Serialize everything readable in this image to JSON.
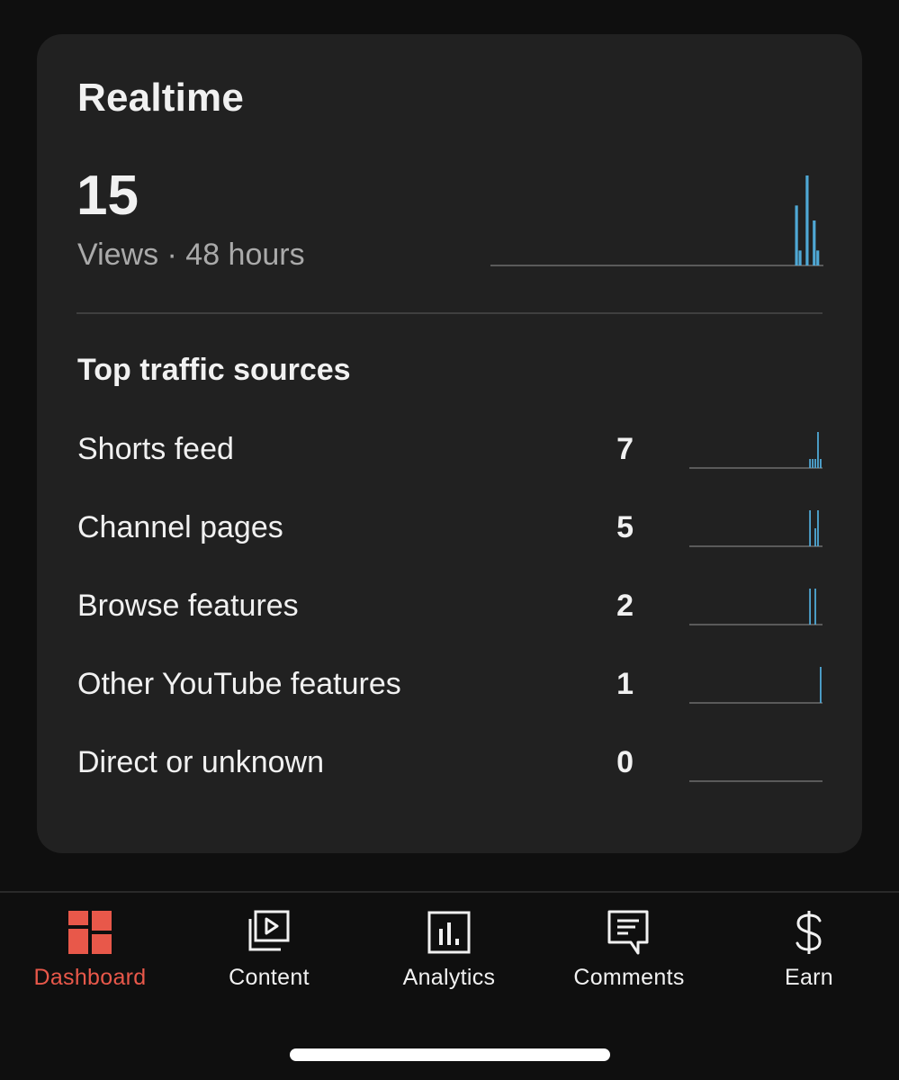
{
  "realtime": {
    "title": "Realtime",
    "views_count": "15",
    "views_label": "Views · 48 hours",
    "spark_values": [
      0,
      0,
      0,
      0,
      0,
      0,
      0,
      0,
      0,
      0,
      0,
      0,
      0,
      0,
      0,
      0,
      0,
      0,
      0,
      0,
      0,
      0,
      0,
      0,
      0,
      0,
      0,
      0,
      0,
      0,
      0,
      0,
      0,
      0,
      0,
      0,
      0,
      0,
      0,
      0,
      0,
      0,
      0,
      0,
      0,
      0,
      0,
      0,
      0,
      0,
      0,
      0,
      0,
      0,
      0,
      0,
      0,
      0,
      0,
      0,
      0,
      0,
      0,
      0,
      0,
      0,
      0,
      0,
      0,
      0,
      0,
      0,
      0,
      0,
      0,
      0,
      0,
      0,
      0,
      0,
      0,
      0,
      0,
      0,
      0,
      0,
      4,
      1,
      0,
      6,
      0,
      3,
      1,
      0
    ]
  },
  "traffic": {
    "title": "Top traffic sources",
    "sources": [
      {
        "label": "Shorts feed",
        "count": "7",
        "spark": [
          1,
          1,
          1,
          4,
          1
        ]
      },
      {
        "label": "Channel pages",
        "count": "5",
        "spark": [
          2,
          0,
          1,
          2,
          0
        ]
      },
      {
        "label": "Browse features",
        "count": "2",
        "spark": [
          1,
          0,
          1,
          0,
          0
        ]
      },
      {
        "label": "Other YouTube features",
        "count": "1",
        "spark": [
          0,
          0,
          0,
          0,
          1
        ]
      },
      {
        "label": "Direct or unknown",
        "count": "0",
        "spark": [
          0,
          0,
          0,
          0,
          0
        ]
      }
    ]
  },
  "nav": {
    "items": [
      {
        "label": "Dashboard",
        "icon": "dashboard-icon",
        "active": true
      },
      {
        "label": "Content",
        "icon": "content-icon",
        "active": false
      },
      {
        "label": "Analytics",
        "icon": "analytics-icon",
        "active": false
      },
      {
        "label": "Comments",
        "icon": "comments-icon",
        "active": false
      },
      {
        "label": "Earn",
        "icon": "earn-icon",
        "active": false
      }
    ]
  },
  "colors": {
    "accent": "#e8584a",
    "spark": "#4fa8d5",
    "baseline": "#5a5a5a"
  }
}
